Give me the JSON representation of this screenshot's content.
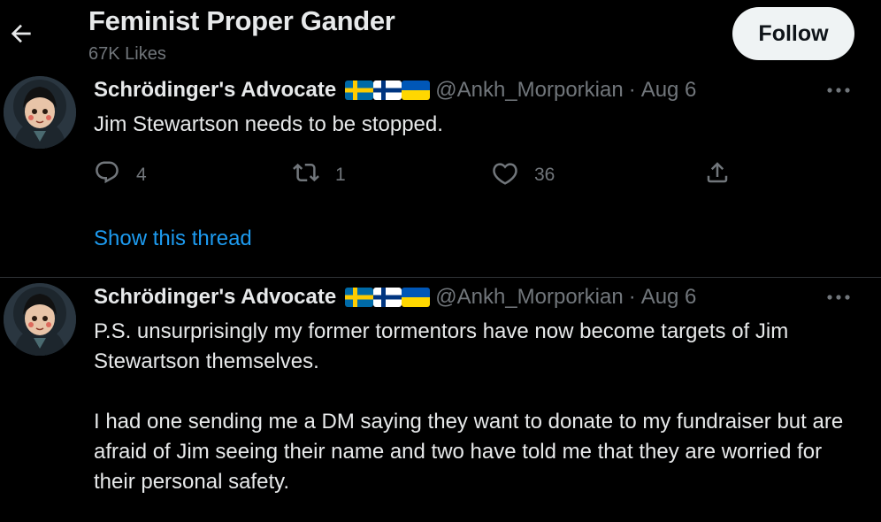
{
  "header": {
    "title": "Feminist Proper Gander",
    "subtitle": "67K Likes",
    "follow_label": "Follow"
  },
  "tweets": [
    {
      "display_name": "Schrödinger's Advocate",
      "flags": [
        "sweden-flag",
        "finland-flag",
        "ukraine-flag"
      ],
      "handle": "@Ankh_Morporkian",
      "separator": "·",
      "date": "Aug 6",
      "text": [
        "Jim Stewartson needs to be stopped."
      ],
      "reply_count": "4",
      "retweet_count": "1",
      "like_count": "36",
      "show_thread_label": "Show this thread"
    },
    {
      "display_name": "Schrödinger's Advocate",
      "flags": [
        "sweden-flag",
        "finland-flag",
        "ukraine-flag"
      ],
      "handle": "@Ankh_Morporkian",
      "separator": "·",
      "date": "Aug 6",
      "text": [
        "P.S. unsurprisingly my former tormentors have now become targets of Jim Stewartson themselves.",
        "I had one sending me a DM saying they want to donate to my fundraiser but are afraid of Jim seeing their name and two have told me that they are worried for their personal safety."
      ]
    }
  ],
  "colors": {
    "background": "#000000",
    "text": "#e7e9ea",
    "secondary": "#71767b",
    "link": "#1d9bf0",
    "divider": "#2f3336"
  }
}
